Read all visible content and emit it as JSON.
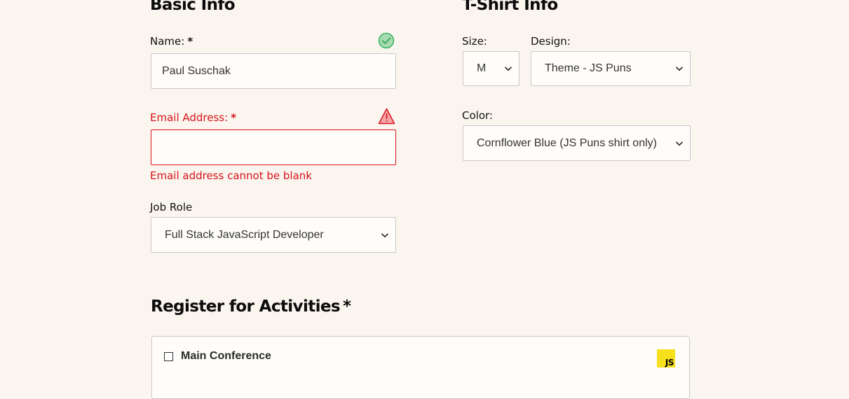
{
  "basic_info": {
    "heading": "Basic Info",
    "name": {
      "label": "Name:",
      "required_mark": "*",
      "value": "Paul Suschak",
      "status_icon": "check-circle-icon"
    },
    "email": {
      "label": "Email Address:",
      "required_mark": "*",
      "value": "",
      "status_icon": "warning-triangle-icon",
      "error_message": "Email address cannot be blank"
    },
    "job_role": {
      "label": "Job Role",
      "selected": "Full Stack JavaScript Developer"
    }
  },
  "tshirt_info": {
    "heading": "T-Shirt Info",
    "size": {
      "label": "Size:",
      "selected": "M"
    },
    "design": {
      "label": "Design:",
      "selected": "Theme - JS Puns"
    },
    "color": {
      "label": "Color:",
      "selected": "Cornflower Blue (JS Puns shirt only)"
    }
  },
  "activities": {
    "heading": "Register for Activities",
    "required_mark": "*",
    "items": [
      {
        "label": "Main Conference",
        "checked": false,
        "badge_text": "JS"
      }
    ]
  },
  "colors": {
    "background": "#faf5ee",
    "error": "#d8141b",
    "valid": "#3cb262",
    "js_badge": "#f7df1e"
  }
}
